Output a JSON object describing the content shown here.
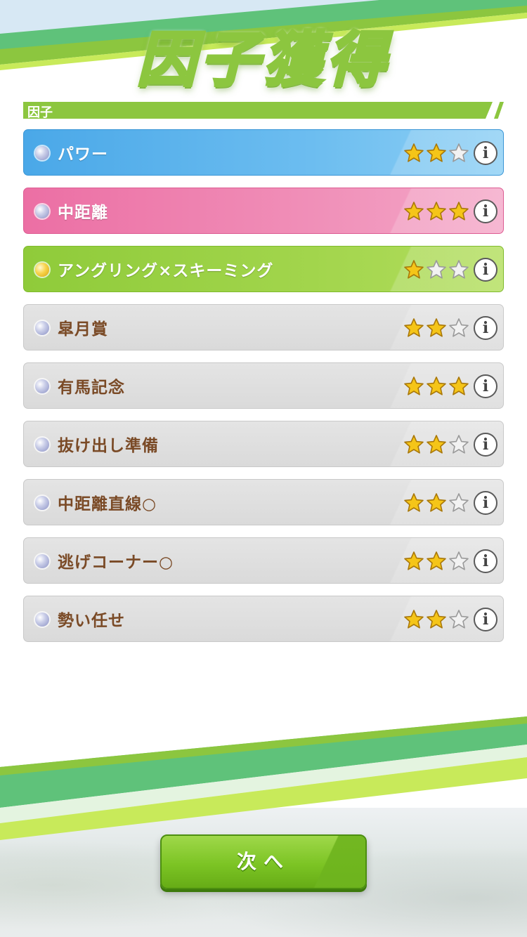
{
  "header": {
    "title": "因子獲得"
  },
  "section": {
    "label": "因子"
  },
  "factors": [
    {
      "name": "パワー",
      "color": "blue",
      "stars": 2,
      "max_stars": 3
    },
    {
      "name": "中距離",
      "color": "pink",
      "stars": 3,
      "max_stars": 3
    },
    {
      "name": "アングリング×スキーミング",
      "color": "green",
      "stars": 1,
      "max_stars": 3
    },
    {
      "name": "皐月賞",
      "color": "gray",
      "stars": 2,
      "max_stars": 3
    },
    {
      "name": "有馬記念",
      "color": "gray",
      "stars": 3,
      "max_stars": 3
    },
    {
      "name": "抜け出し準備",
      "color": "gray",
      "stars": 2,
      "max_stars": 3
    },
    {
      "name": "中距離直線○",
      "color": "gray",
      "stars": 2,
      "max_stars": 3
    },
    {
      "name": "逃げコーナー○",
      "color": "gray",
      "stars": 2,
      "max_stars": 3
    },
    {
      "name": "勢い任せ",
      "color": "gray",
      "stars": 2,
      "max_stars": 3
    }
  ],
  "info_glyph": "i",
  "next_button": {
    "label": "次へ"
  },
  "colors": {
    "accent_green": "#8cc63f",
    "blue_factor": "#4aa8e8",
    "pink_factor": "#ec6fa4",
    "green_factor": "#8fcb3a",
    "gray_factor": "#dadada",
    "brown_text": "#7a4a26",
    "star_gold": "#f5c518"
  }
}
